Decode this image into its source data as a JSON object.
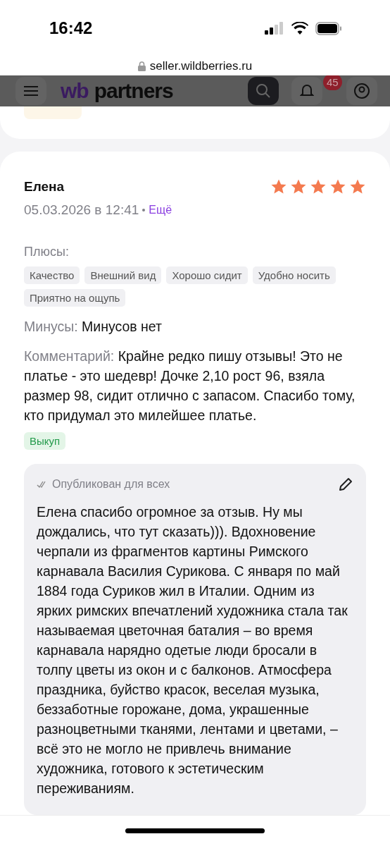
{
  "status_bar": {
    "time": "16:42"
  },
  "browser": {
    "url": "seller.wildberries.ru"
  },
  "header": {
    "logo_mark": "wb",
    "logo_text": "partners",
    "notifications_badge": "45"
  },
  "review": {
    "author": "Елена",
    "stars": 5,
    "date": "05.03.2026 в 12:41",
    "more_link": "Ещё",
    "pros_label": "Плюсы:",
    "pros_tags": [
      "Качество",
      "Внешний вид",
      "Хорошо сидит",
      "Удобно носить",
      "Приятно на ощупь"
    ],
    "cons_label": "Минусы:",
    "cons_text": "Минусов нет",
    "comment_label": "Комментарий:",
    "comment_text": "Крайне редко пишу отзывы! Это не платье - это шедевр! Дочке 2,10 рост 96, взяла размер 98, сидит отлично с запасом. Спасибо тому, кто придумал это милейшее платье.",
    "status_tag": "Выкуп",
    "reply": {
      "status": "Опубликован для всех",
      "text": "Елена спасибо огромное за отзыв. Ну мы дождались, что тут сказать))). Вдохновение черпали из фрагментов картины Римского карнавала Василия Сурикова. С января по май 1884 года Суриков жил в Италии. Одним из ярких римских впечатлений художника стала так называемая цветочная баталия – во время карнавала нарядно одетые люди бросали в толпу цветы из окон и с балконов. Атмосфера праздника, буйство красок, веселая музыка, беззаботные горожане, дома, украшенные разноцветными тканями, лентами и цветами, – всё это не могло не привлечь внимание художника, готового к эстетическим переживаниям."
    }
  }
}
